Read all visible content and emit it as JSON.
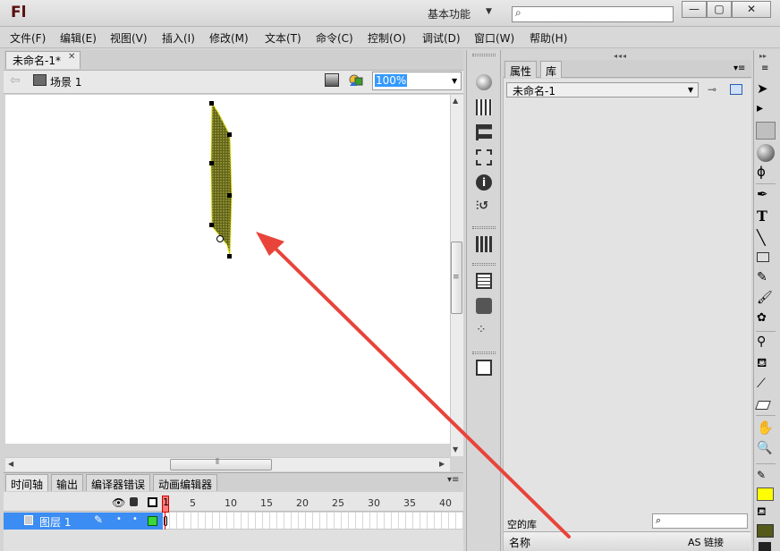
{
  "app": {
    "logo": "Fl",
    "workspace": "基本功能",
    "window_buttons": [
      "—",
      "▢",
      "✕"
    ]
  },
  "menus": [
    "文件(F)",
    "编辑(E)",
    "视图(V)",
    "插入(I)",
    "修改(M)",
    "文本(T)",
    "命令(C)",
    "控制(O)",
    "调试(D)",
    "窗口(W)",
    "帮助(H)"
  ],
  "document": {
    "tab_label": "未命名-1*",
    "scene": "场景 1",
    "zoom": "100%"
  },
  "timeline": {
    "tabs": [
      "时间轴",
      "输出",
      "编译器错误",
      "动画编辑器"
    ],
    "ruler": [
      "1",
      "5",
      "10",
      "15",
      "20",
      "25",
      "30",
      "35",
      "40"
    ],
    "layer_name": "图层 1"
  },
  "library": {
    "tabs": [
      "属性",
      "库"
    ],
    "selected": "未命名-1",
    "empty_label": "空的库",
    "columns": [
      "名称",
      "AS 链接"
    ]
  },
  "colors": {
    "stroke": "#ffff00",
    "fill": "#555a1a",
    "arrow": "#e8443a",
    "shape": "#5f6118"
  }
}
